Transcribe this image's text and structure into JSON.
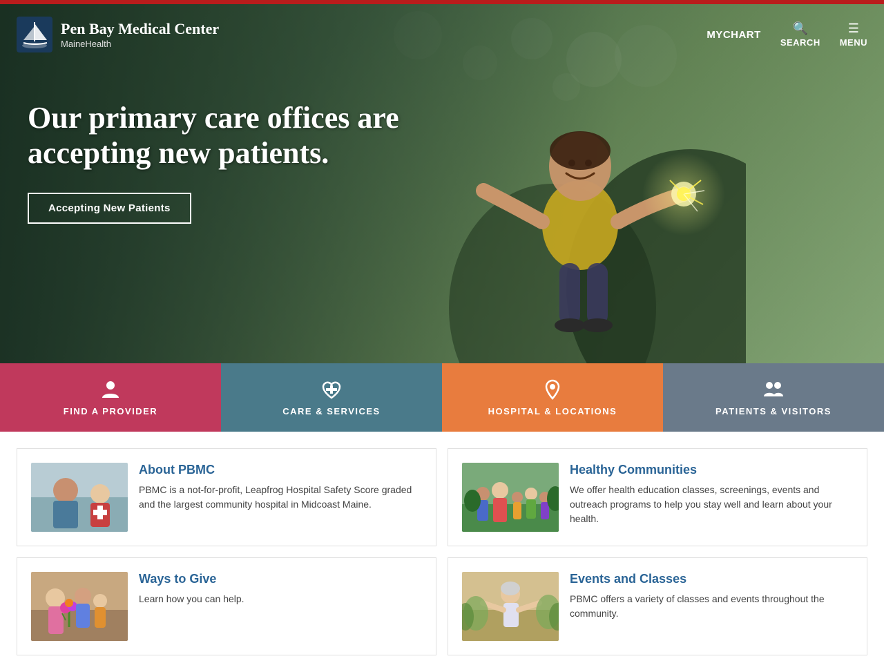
{
  "topbar": {},
  "header": {
    "logo": {
      "main_name": "Pen Bay Medical Center",
      "sub_name": "MaineHealth"
    },
    "nav": {
      "mychart_label": "MYCHART",
      "search_label": "SEARCH",
      "menu_label": "MENU"
    }
  },
  "hero": {
    "headline": "Our primary care offices are accepting new patients.",
    "cta_label": "Accepting New Patients"
  },
  "quick_links": [
    {
      "id": "find-provider",
      "icon": "person",
      "label": "FIND A PROVIDER"
    },
    {
      "id": "care-services",
      "icon": "heartbeat",
      "label": "CARE & SERVICES"
    },
    {
      "id": "hospital-locations",
      "icon": "location",
      "label": "HOSPITAL & LOCATIONS"
    },
    {
      "id": "patients-visitors",
      "icon": "people",
      "label": "PATIENTS & VISITORS"
    }
  ],
  "cards": [
    {
      "id": "about-pbmc",
      "title": "About PBMC",
      "desc": "PBMC is a not-for-profit, Leapfrog Hospital Safety Score graded and the largest community hospital in Midcoast Maine.",
      "img_color": "#a0b8c0"
    },
    {
      "id": "healthy-communities",
      "title": "Healthy Communities",
      "desc": "We offer health education classes, screenings, events and outreach programs to help you stay well and learn about your health.",
      "img_color": "#7aaa7a"
    },
    {
      "id": "ways-to-give",
      "title": "Ways to Give",
      "desc": "Learn how you can help.",
      "img_color": "#c8a080"
    },
    {
      "id": "events-classes",
      "title": "Events and Classes",
      "desc": "PBMC offers a variety of classes and events throughout the community.",
      "img_color": "#d4c090"
    }
  ]
}
